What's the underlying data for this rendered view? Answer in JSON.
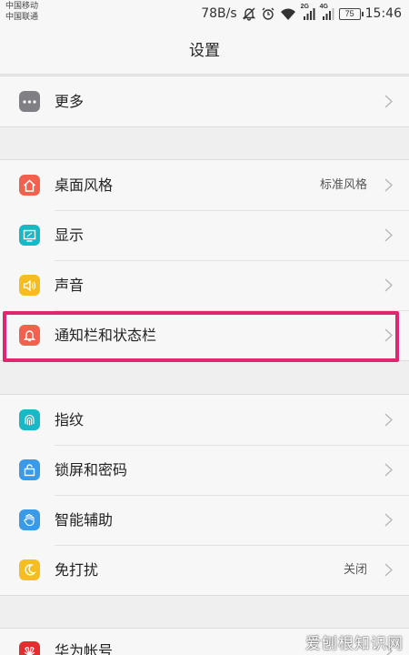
{
  "status": {
    "carrier1": "中国移动",
    "carrier2": "中国联通",
    "speed": "78B/s",
    "sig1_tag": "2G",
    "sig2_tag": "4G",
    "battery": "75",
    "time": "15:46"
  },
  "title": "设置",
  "groups": [
    {
      "items": [
        {
          "label": "更多",
          "icon": "more-icon",
          "color": "#7f7f84"
        }
      ]
    },
    {
      "items": [
        {
          "label": "桌面风格",
          "value": "标准风格",
          "icon": "home-icon",
          "color": "#f1614d"
        },
        {
          "label": "显示",
          "icon": "display-icon",
          "color": "#19b8c6"
        },
        {
          "label": "声音",
          "icon": "speaker-icon",
          "color": "#f5bd1f"
        },
        {
          "label": "通知栏和状态栏",
          "icon": "bell-icon",
          "color": "#f1614d"
        }
      ]
    },
    {
      "items": [
        {
          "label": "指纹",
          "icon": "fingerprint-icon",
          "color": "#19b8c6"
        },
        {
          "label": "锁屏和密码",
          "icon": "lock-icon",
          "color": "#3a9ae8"
        },
        {
          "label": "智能辅助",
          "icon": "hand-icon",
          "color": "#3a9ae8"
        },
        {
          "label": "免打扰",
          "value": "关闭",
          "icon": "moon-icon",
          "color": "#f5bd1f"
        }
      ]
    },
    {
      "items": [
        {
          "label": "华为帐号",
          "icon": "huawei-icon",
          "color": "#e22e2e"
        }
      ]
    }
  ],
  "watermark": "爱刨根知识网"
}
